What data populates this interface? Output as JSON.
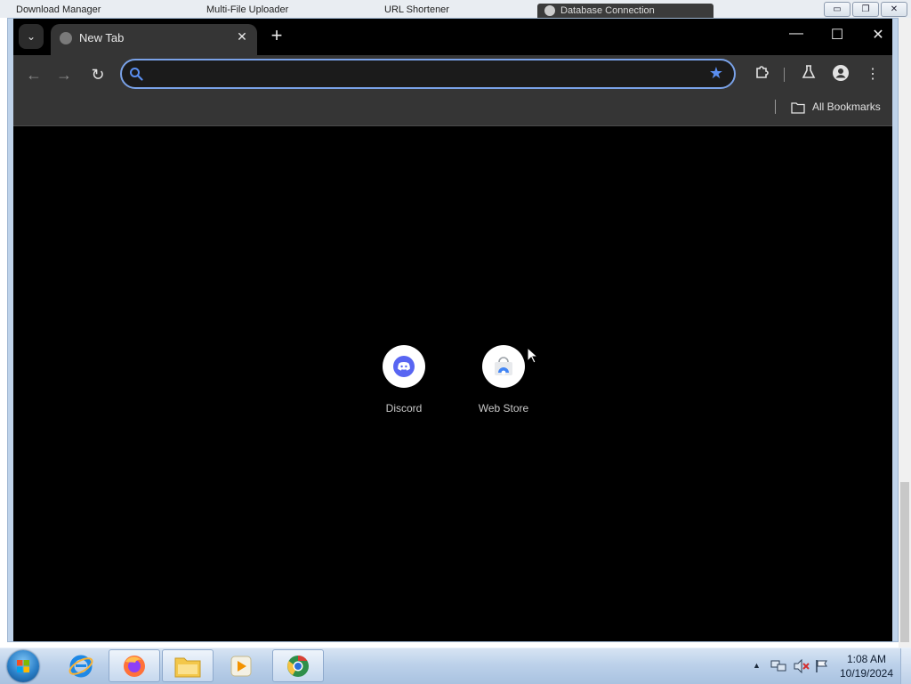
{
  "background_app": {
    "title_fragments": [
      "Download Manager",
      "Multi-File Uploader",
      "URL Shortener",
      "Database Connection"
    ]
  },
  "browser": {
    "tab_search_icon": "chevron-down-icon",
    "tabs": [
      {
        "title": "New Tab",
        "close_label": "✕"
      }
    ],
    "new_tab_label": "+",
    "window_controls": {
      "minimize": "—",
      "maximize": "☐",
      "close": "✕"
    },
    "omnibox": {
      "value": "",
      "placeholder": ""
    },
    "bookmarks_bar": {
      "all_bookmarks_label": "All Bookmarks"
    },
    "shortcuts": [
      {
        "name": "Discord",
        "icon": "discord-icon"
      },
      {
        "name": "Web Store",
        "icon": "web-store-icon"
      }
    ],
    "accent_color": "#7aa2e8",
    "star_color": "#5a8ef0"
  },
  "taskbar": {
    "clock": {
      "time": "1:08 AM",
      "date": "10/19/2024"
    }
  }
}
